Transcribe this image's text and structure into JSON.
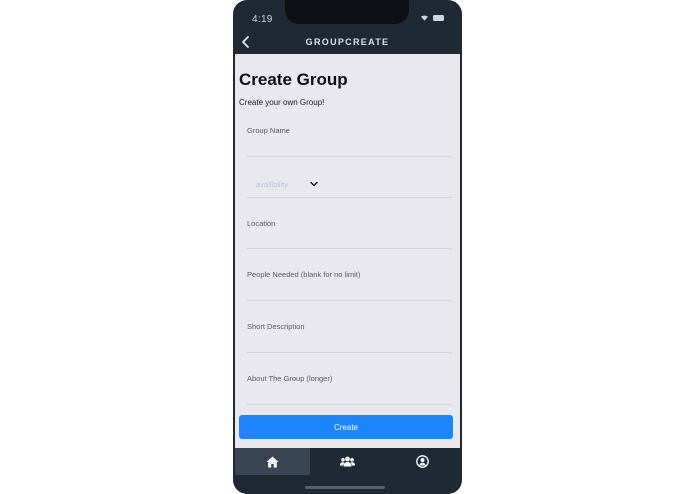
{
  "status_bar": {
    "time": "4:19"
  },
  "nav": {
    "title": "GROUPCREATE"
  },
  "page": {
    "title": "Create Group",
    "subtitle": "Create your own Group!"
  },
  "form": {
    "group_name_label": "Group Name",
    "availability_value": "availibility",
    "location_label": "Location",
    "people_needed_label": "People Needed (blank for no limit)",
    "short_description_label": "Short Description",
    "about_label": "About The Group (longer)"
  },
  "actions": {
    "create_label": "Create"
  },
  "tabs": [
    {
      "icon": "home-icon",
      "active": true
    },
    {
      "icon": "group-icon",
      "active": false
    },
    {
      "icon": "profile-icon",
      "active": false
    }
  ],
  "colors": {
    "accent": "#1a85ff",
    "nav_background": "#1f2933",
    "content_background": "#e9e8ee",
    "placeholder": "#b8bfd3"
  }
}
